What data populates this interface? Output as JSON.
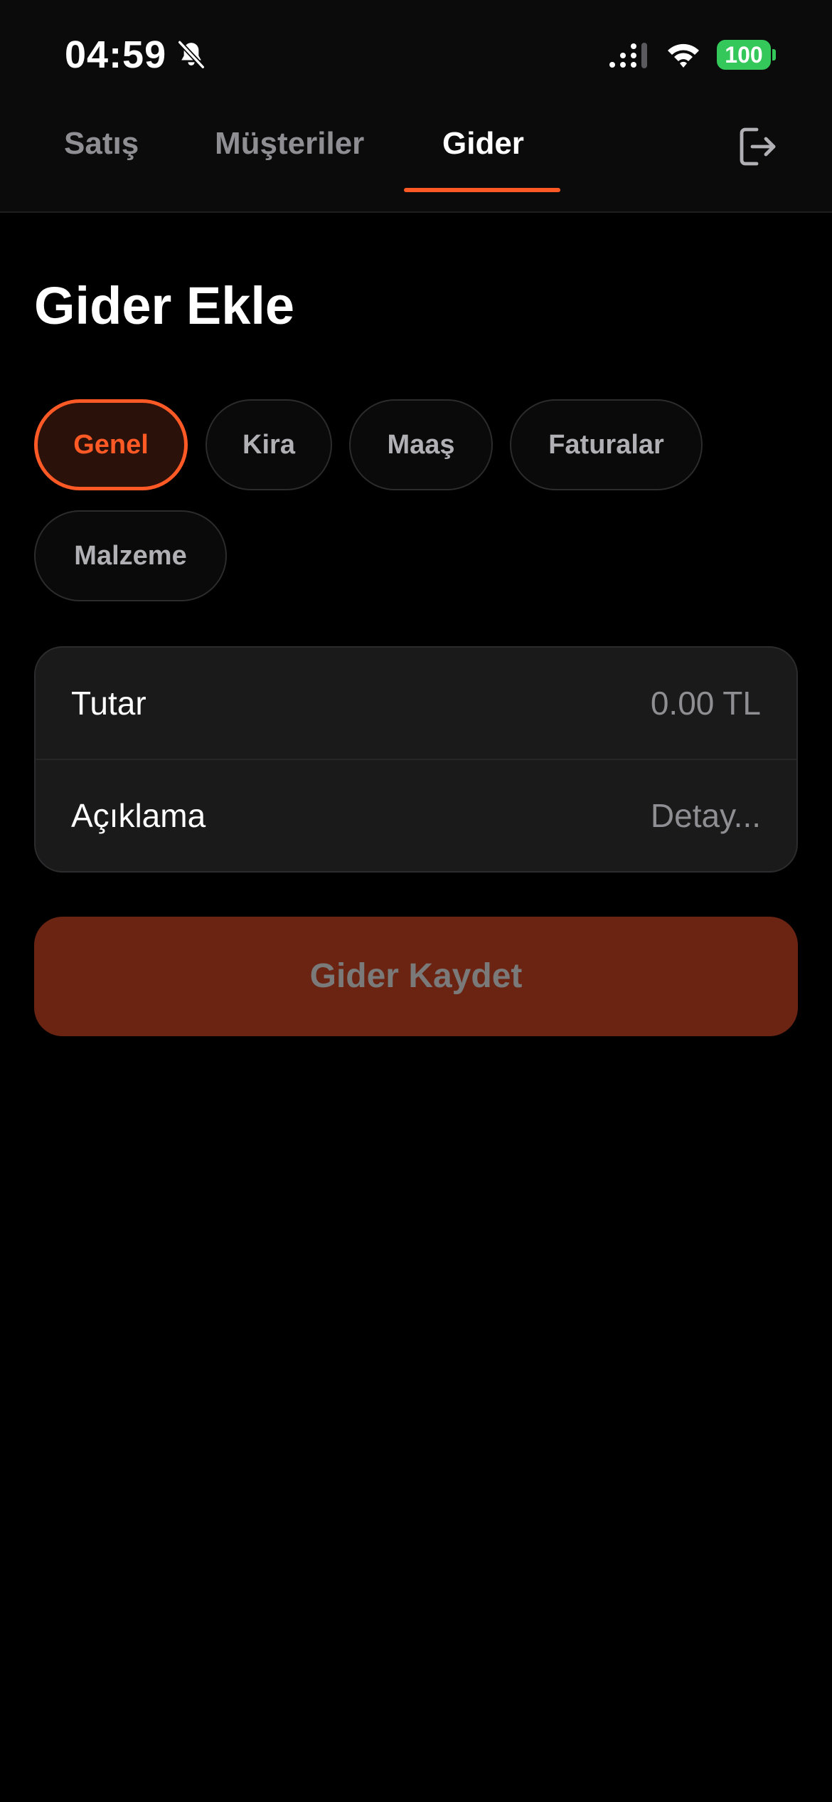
{
  "status_bar": {
    "time": "04:59",
    "battery": "100",
    "icons": [
      "bell-slash-icon",
      "cellular-signal-icon",
      "wifi-icon",
      "battery-icon"
    ]
  },
  "tabs": [
    {
      "label": "Satış",
      "active": false
    },
    {
      "label": "Müşteriler",
      "active": false
    },
    {
      "label": "Gider",
      "active": true
    }
  ],
  "header_icons": [
    "logout-icon"
  ],
  "page": {
    "title": "Gider Ekle"
  },
  "categories": {
    "items": [
      "Genel",
      "Kira",
      "Maaş",
      "Faturalar",
      "Malzeme"
    ],
    "selected": "Genel"
  },
  "form": {
    "amount": {
      "label": "Tutar",
      "value": "",
      "placeholder": "0.00 TL"
    },
    "description": {
      "label": "Açıklama",
      "value": "",
      "placeholder": "Detay..."
    }
  },
  "save_button": {
    "label": "Gider Kaydet"
  },
  "colors": {
    "accent": "#ff5a26",
    "background": "#000000",
    "card": "#1a1a1a",
    "button_disabled": "#6b2412",
    "battery": "#34c759"
  }
}
